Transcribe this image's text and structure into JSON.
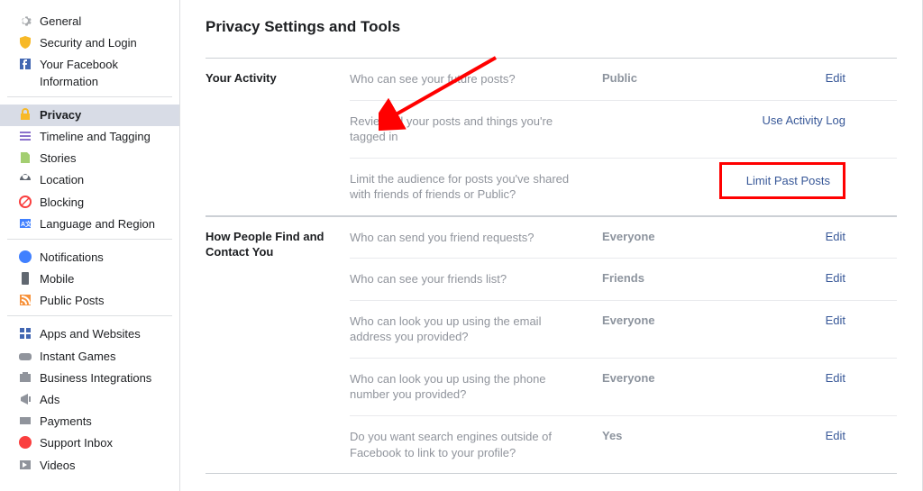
{
  "page": {
    "title": "Privacy Settings and Tools"
  },
  "sidebar": {
    "groups": [
      {
        "items": [
          {
            "label": "General",
            "icon": "gear"
          },
          {
            "label": "Security and Login",
            "icon": "shield"
          },
          {
            "label": "Your Facebook Information",
            "icon": "fb"
          }
        ]
      },
      {
        "items": [
          {
            "label": "Privacy",
            "icon": "lock",
            "active": true
          },
          {
            "label": "Timeline and Tagging",
            "icon": "timeline"
          },
          {
            "label": "Stories",
            "icon": "stories"
          },
          {
            "label": "Location",
            "icon": "location"
          },
          {
            "label": "Blocking",
            "icon": "block"
          },
          {
            "label": "Language and Region",
            "icon": "language"
          }
        ]
      },
      {
        "items": [
          {
            "label": "Notifications",
            "icon": "globe"
          },
          {
            "label": "Mobile",
            "icon": "mobile"
          },
          {
            "label": "Public Posts",
            "icon": "rss"
          }
        ]
      },
      {
        "items": [
          {
            "label": "Apps and Websites",
            "icon": "apps"
          },
          {
            "label": "Instant Games",
            "icon": "games"
          },
          {
            "label": "Business Integrations",
            "icon": "business"
          },
          {
            "label": "Ads",
            "icon": "ads"
          },
          {
            "label": "Payments",
            "icon": "payments"
          },
          {
            "label": "Support Inbox",
            "icon": "support"
          },
          {
            "label": "Videos",
            "icon": "videos"
          }
        ]
      }
    ]
  },
  "sections": [
    {
      "header": "Your Activity",
      "rows": [
        {
          "label": "Who can see your future posts?",
          "value": "Public",
          "action": "Edit"
        },
        {
          "label": "Review all your posts and things you're tagged in",
          "value": "",
          "action": "Use Activity Log"
        },
        {
          "label": "Limit the audience for posts you've shared with friends of friends or Public?",
          "value": "",
          "action": "Limit Past Posts",
          "highlight": true
        }
      ]
    },
    {
      "header": "How People Find and Contact You",
      "rows": [
        {
          "label": "Who can send you friend requests?",
          "value": "Everyone",
          "action": "Edit"
        },
        {
          "label": "Who can see your friends list?",
          "value": "Friends",
          "action": "Edit"
        },
        {
          "label": "Who can look you up using the email address you provided?",
          "value": "Everyone",
          "action": "Edit"
        },
        {
          "label": "Who can look you up using the phone number you provided?",
          "value": "Everyone",
          "action": "Edit"
        },
        {
          "label": "Do you want search engines outside of Facebook to link to your profile?",
          "value": "Yes",
          "action": "Edit"
        }
      ]
    }
  ],
  "colors": {
    "link": "#385898",
    "highlight": "#ff0000"
  }
}
